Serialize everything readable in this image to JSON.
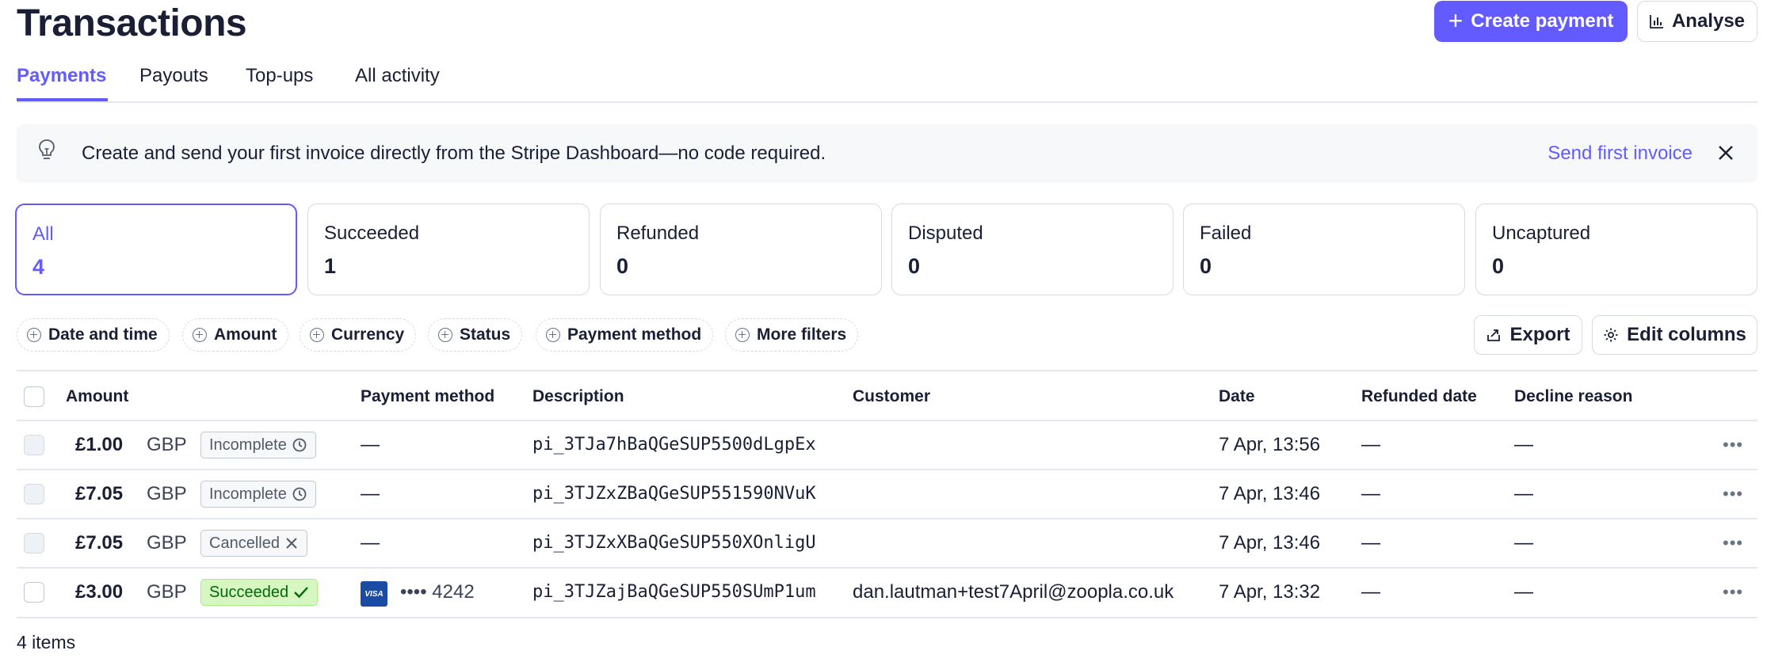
{
  "header": {
    "title": "Transactions",
    "create_payment_label": "Create payment",
    "analyse_label": "Analyse"
  },
  "tabs": [
    {
      "label": "Payments",
      "active": true
    },
    {
      "label": "Payouts",
      "active": false
    },
    {
      "label": "Top-ups",
      "active": false
    },
    {
      "label": "All activity",
      "active": false
    }
  ],
  "banner": {
    "text": "Create and send your first invoice directly from the Stripe Dashboard—no code required.",
    "link": "Send first invoice",
    "icon": "lightbulb-icon"
  },
  "status_cards": [
    {
      "label": "All",
      "count": "4",
      "active": true
    },
    {
      "label": "Succeeded",
      "count": "1"
    },
    {
      "label": "Refunded",
      "count": "0"
    },
    {
      "label": "Disputed",
      "count": "0"
    },
    {
      "label": "Failed",
      "count": "0"
    },
    {
      "label": "Uncaptured",
      "count": "0"
    }
  ],
  "filters": [
    "Date and time",
    "Amount",
    "Currency",
    "Status",
    "Payment method",
    "More filters"
  ],
  "actions": {
    "export": "Export",
    "edit_columns": "Edit columns"
  },
  "table": {
    "columns": [
      "Amount",
      "Payment method",
      "Description",
      "Customer",
      "Date",
      "Refunded date",
      "Decline reason"
    ],
    "rows": [
      {
        "amount": "£1.00",
        "currency": "GBP",
        "status": "Incomplete",
        "status_icon": "clock-icon",
        "payment_method": "—",
        "description": "pi_3TJa7hBaQGeSUP5500dLgpEx",
        "customer": "",
        "date": "7 Apr, 13:56",
        "refunded_date": "—",
        "decline_reason": "—"
      },
      {
        "amount": "£7.05",
        "currency": "GBP",
        "status": "Incomplete",
        "status_icon": "clock-icon",
        "payment_method": "—",
        "description": "pi_3TJZxZBaQGeSUP551590NVuK",
        "customer": "",
        "date": "7 Apr, 13:46",
        "refunded_date": "—",
        "decline_reason": "—"
      },
      {
        "amount": "£7.05",
        "currency": "GBP",
        "status": "Cancelled",
        "status_icon": "x-icon",
        "payment_method": "—",
        "description": "pi_3TJZxXBaQGeSUP550XOnligU",
        "customer": "",
        "date": "7 Apr, 13:46",
        "refunded_date": "—",
        "decline_reason": "—"
      },
      {
        "amount": "£3.00",
        "currency": "GBP",
        "status": "Succeeded",
        "status_icon": "check-icon",
        "payment_method": "•••• 4242",
        "card_brand": "VISA",
        "description": "pi_3TJZajBaQGeSUP550SUmP1um",
        "customer": "dan.lautman+test7April@zoopla.co.uk",
        "date": "7 Apr, 13:32",
        "refunded_date": "—",
        "decline_reason": "—"
      }
    ]
  },
  "footer": {
    "count": "4 items"
  },
  "colors": {
    "accent": "#635bff",
    "success_bg": "#d7f7c2",
    "success_text": "#006908",
    "border": "#d5dbe1"
  }
}
